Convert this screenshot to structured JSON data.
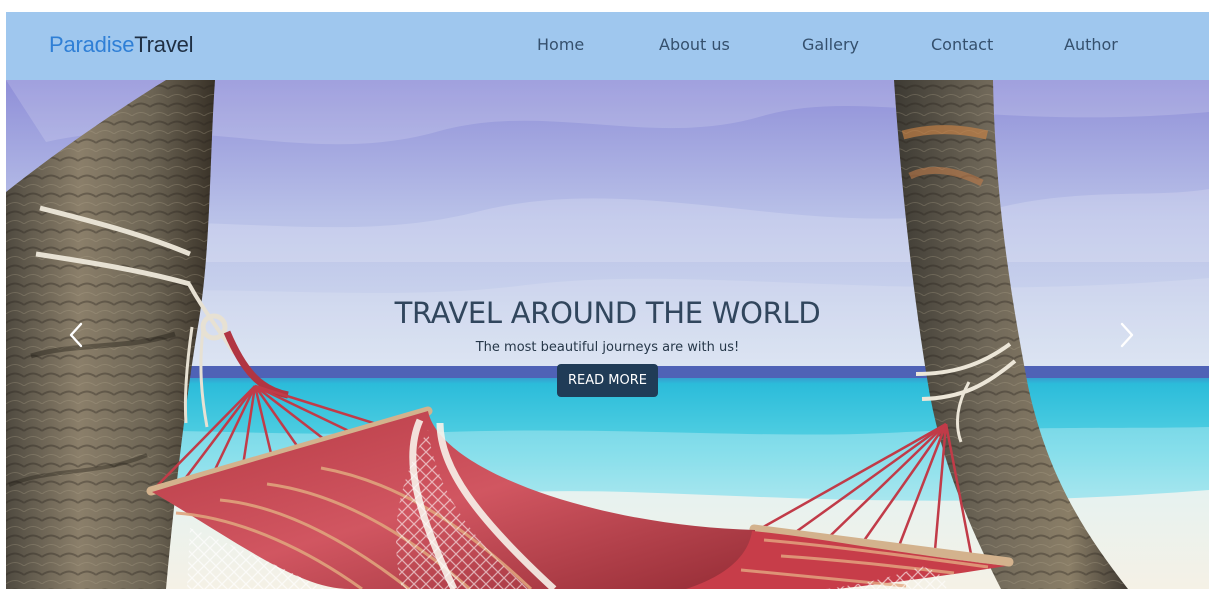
{
  "brand": {
    "first": "Paradise",
    "second": "Travel",
    "first_color": "#2f7fd6",
    "second_color": "#1f2f43"
  },
  "nav": {
    "items": [
      {
        "label": "Home"
      },
      {
        "label": "About us"
      },
      {
        "label": "Gallery"
      },
      {
        "label": "Contact"
      },
      {
        "label": "Author"
      }
    ]
  },
  "hero": {
    "image": "beach-hammock-palm-trees",
    "title": "TRAVEL AROUND THE WORLD",
    "subtitle": "The most beautiful journeys are with us!",
    "cta_label": "READ MORE",
    "prev_icon": "chevron-left-icon",
    "next_icon": "chevron-right-icon"
  },
  "colors": {
    "navbar": "#9fc7ee",
    "nav_text": "#35506d",
    "title": "#31465d",
    "button": "#203c57",
    "button_text": "#ffffff"
  }
}
